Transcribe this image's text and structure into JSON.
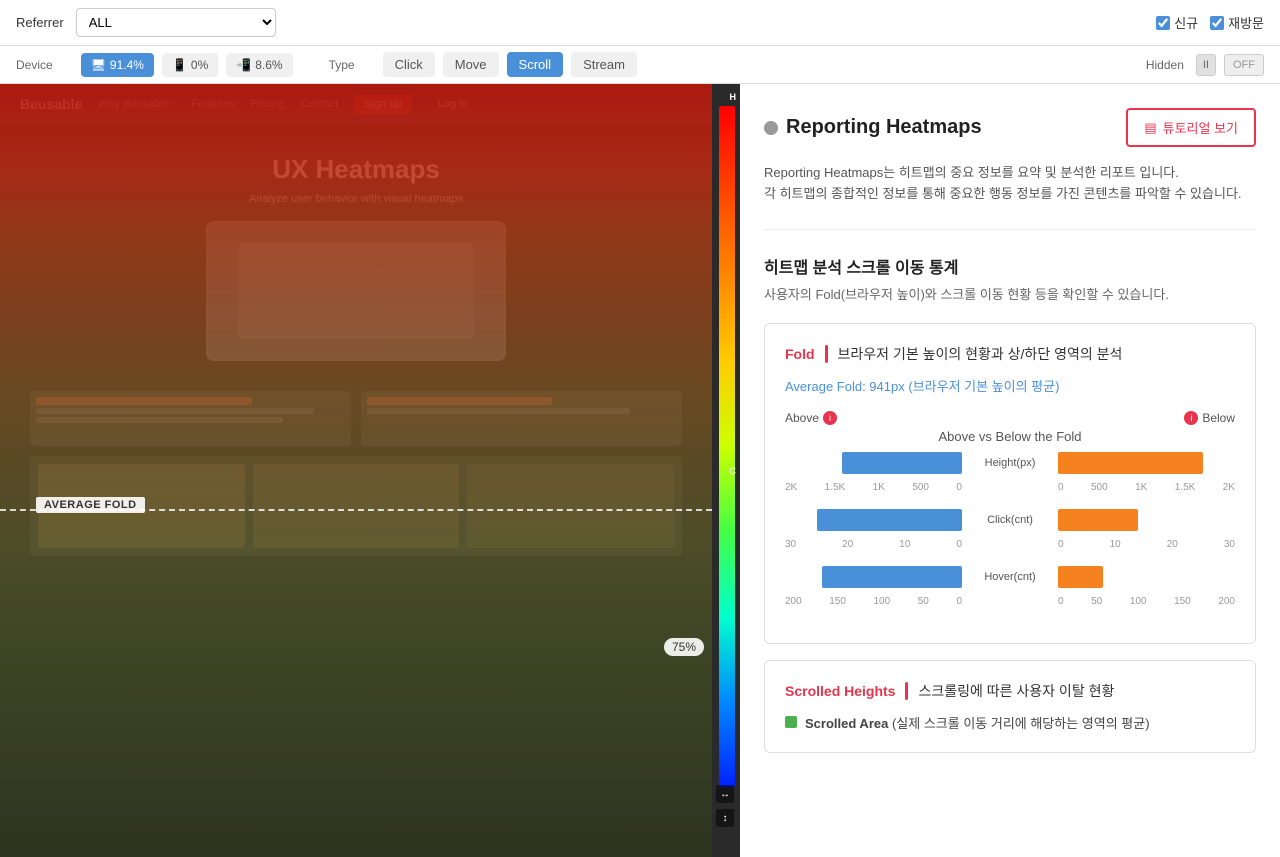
{
  "topbar": {
    "referrer_label": "Referrer",
    "referrer_value": "ALL",
    "checkbox_new_label": "신규",
    "checkbox_return_label": "재방문"
  },
  "secondbar": {
    "device_label": "Device",
    "devices": [
      {
        "label": "91.4%",
        "icon": "desktop",
        "active": true
      },
      {
        "label": "0%",
        "icon": "tablet",
        "active": false
      },
      {
        "label": "8.6%",
        "icon": "mobile",
        "active": false
      }
    ],
    "type_label": "Type",
    "types": [
      {
        "label": "Click",
        "active": false
      },
      {
        "label": "Move",
        "active": false
      },
      {
        "label": "Scroll",
        "active": true
      },
      {
        "label": "Stream",
        "active": false
      }
    ],
    "hidden_label": "Hidden",
    "toggle_pause": "II",
    "toggle_off": "OFF"
  },
  "heatmap": {
    "avg_fold_label": "AVERAGE FOLD",
    "percent_label": "75%",
    "scale_h": "H",
    "scale_c": "C"
  },
  "right_panel": {
    "title": "Reporting Heatmaps",
    "tutorial_btn": "튜토리얼 보기",
    "desc_1": "Reporting Heatmaps는 히트맵의 중요 정보를 요약 및 분석한 리포트 입니다.",
    "desc_2": "각 히트맵의 종합적인 정보를 통해 중요한 행동 정보를 가진 콘텐츠를 파악할 수 있습니다.",
    "section_title": "히트맵 분석   스크롤 이동 통계",
    "section_subtitle": "사용자의 Fold(브라우저 높이)와 스크롤 이동 현황 등을 확인할 수 있습니다.",
    "fold_card": {
      "tag": "Fold",
      "title": "브라우저 기본 높이의 현황과 상/하단 영역의 분석",
      "avg_label": "Average Fold: 941px",
      "avg_sub": "(브라우저 기본 높이의 평균)",
      "above_label": "Above",
      "below_label": "Below",
      "chart_title": "Above vs Below the Fold",
      "bar_metric_1": "Height(px)",
      "bar_metric_2": "Click(cnt)",
      "bar_metric_3": "Hover(cnt)",
      "axis_height_left": [
        "2K",
        "1.5K",
        "1K",
        "500",
        "0"
      ],
      "axis_height_right": [
        "0",
        "500",
        "1K",
        "1.5K",
        "2K"
      ],
      "axis_click_left": [
        "30",
        "20",
        "10",
        "0"
      ],
      "axis_click_right": [
        "0",
        "10",
        "20",
        "30"
      ],
      "axis_hover_left": [
        "200",
        "150",
        "100",
        "50",
        "0"
      ],
      "axis_hover_right": [
        "0",
        "50",
        "100",
        "150",
        "200"
      ],
      "height_bar_above_width": 120,
      "height_bar_below_width": 145,
      "click_bar_above_width": 145,
      "click_bar_below_width": 80,
      "hover_bar_above_width": 140,
      "hover_bar_below_width": 45
    },
    "scrolled_card": {
      "tag": "Scrolled Heights",
      "title": "스크롤링에 따른 사용자 이탈 현황",
      "scrolled_area_label": "Scrolled Area",
      "scrolled_area_sub": "(실제 스크롤 이동 거리에 해당하는 영역의 평균)"
    }
  }
}
